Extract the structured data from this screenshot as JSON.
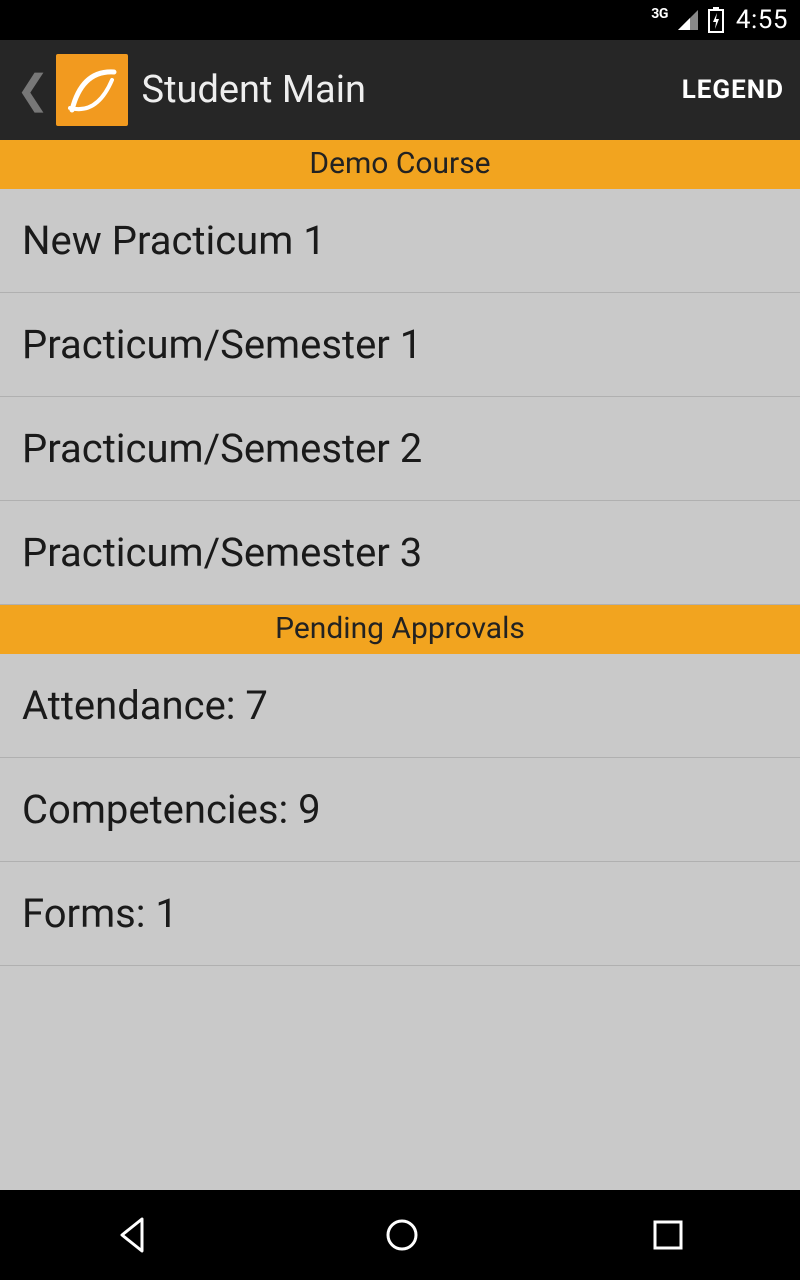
{
  "status": {
    "network": "3G",
    "time": "4:55"
  },
  "appbar": {
    "title": "Student Main",
    "legend": "LEGEND"
  },
  "sections": {
    "course_header": "Demo Course",
    "approvals_header": "Pending Approvals"
  },
  "course_items": [
    "New Practicum 1",
    "Practicum/Semester 1",
    "Practicum/Semester 2",
    "Practicum/Semester 3"
  ],
  "approval_items": [
    "Attendance: 7",
    "Competencies: 9",
    "Forms: 1"
  ]
}
